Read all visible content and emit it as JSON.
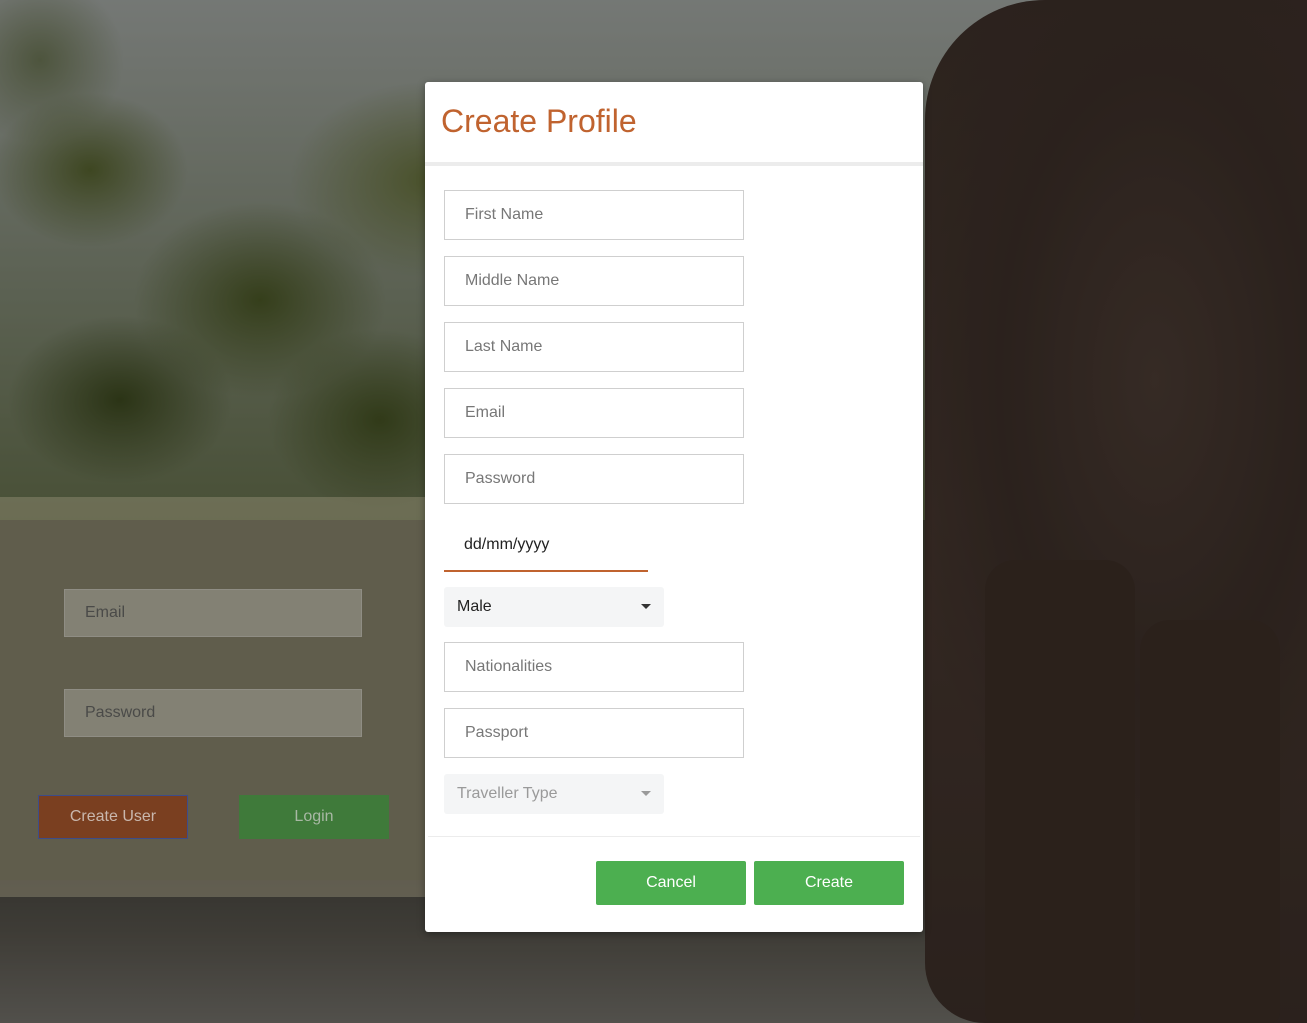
{
  "background": {
    "login_panel": {
      "email_placeholder": "Email",
      "password_placeholder": "Password",
      "create_user_label": "Create User",
      "login_label": "Login"
    }
  },
  "modal": {
    "title": "Create Profile",
    "fields": {
      "first_name_placeholder": "First Name",
      "middle_name_placeholder": "Middle Name",
      "last_name_placeholder": "Last Name",
      "email_placeholder": "Email",
      "password_placeholder": "Password",
      "date_of_birth_placeholder": "dd/mm/yyyy",
      "gender_selected": "Male",
      "nationalities_placeholder": "Nationalities",
      "passport_placeholder": "Passport",
      "traveller_type_placeholder": "Traveller Type"
    },
    "footer": {
      "cancel_label": "Cancel",
      "create_label": "Create"
    }
  },
  "colors": {
    "accent": "#c0632f",
    "primary_button": "#4caf50",
    "title": "#c0632f"
  }
}
